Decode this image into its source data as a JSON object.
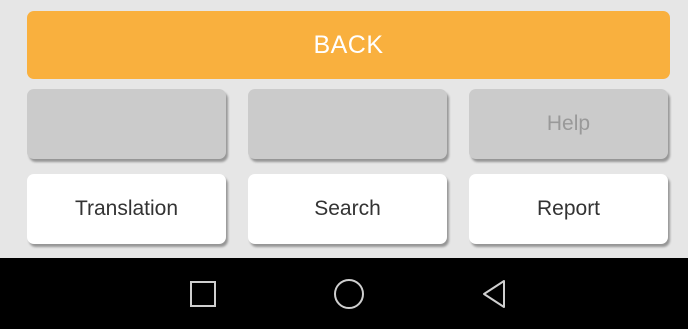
{
  "top_bar": {
    "back_label": "BACK",
    "accent_color": "#f9b03e"
  },
  "grid": {
    "row1": [
      {
        "label": "",
        "state": "disabled"
      },
      {
        "label": "",
        "state": "disabled"
      },
      {
        "label": "Help",
        "state": "disabled"
      }
    ],
    "row2": [
      {
        "label": "Translation",
        "state": "enabled"
      },
      {
        "label": "Search",
        "state": "enabled"
      },
      {
        "label": "Report",
        "state": "enabled"
      }
    ]
  },
  "navbar": {
    "icons": [
      "recent-apps-icon",
      "home-icon",
      "back-triangle-icon"
    ]
  }
}
